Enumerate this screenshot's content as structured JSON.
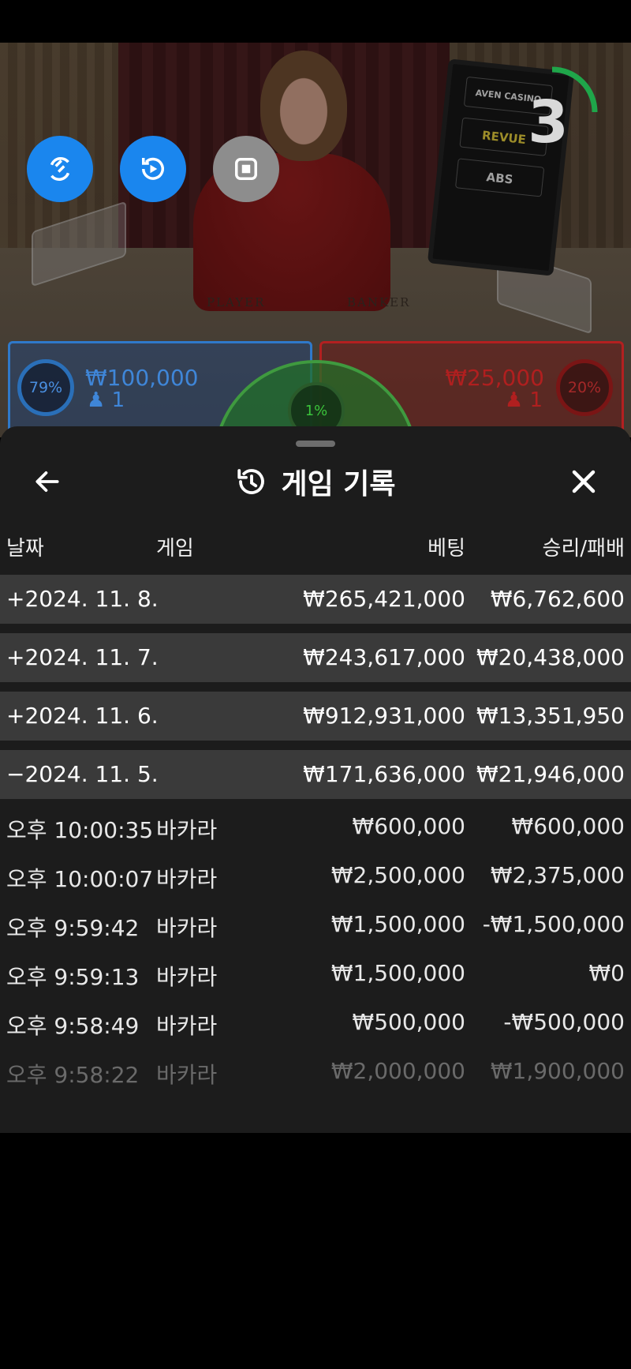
{
  "video": {
    "felt_player": "PLAYER",
    "felt_banker": "BANKER",
    "monitor_brands": [
      "AVEN CASINO",
      "REVUE",
      "ABS"
    ],
    "timer_seconds": "3"
  },
  "controls": {
    "buttons": [
      "switch-camera",
      "auto-play",
      "stop"
    ]
  },
  "betting": {
    "player": {
      "percent": "79%",
      "amount": "₩100,000",
      "players": "1"
    },
    "banker": {
      "percent": "20%",
      "amount": "₩25,000",
      "players": "1"
    },
    "tie": {
      "percent": "1%"
    }
  },
  "history": {
    "title": "게임 기록",
    "columns": {
      "date": "날짜",
      "game": "게임",
      "bet": "베팅",
      "win_loss": "승리/패배"
    },
    "days": [
      {
        "date": "+2024. 11. 8.",
        "bet": "₩265,421,000",
        "win": "₩6,762,600"
      },
      {
        "date": "+2024. 11. 7.",
        "bet": "₩243,617,000",
        "win": "₩20,438,000"
      },
      {
        "date": "+2024. 11. 6.",
        "bet": "₩912,931,000",
        "win": "₩13,351,950"
      },
      {
        "date": "−2024. 11. 5.",
        "bet": "₩171,636,000",
        "win": "₩21,946,000"
      }
    ],
    "entries": [
      {
        "time": "오후 10:00:35",
        "game": "바카라",
        "bet": "₩600,000",
        "win": "₩600,000"
      },
      {
        "time": "오후 10:00:07",
        "game": "바카라",
        "bet": "₩2,500,000",
        "win": "₩2,375,000"
      },
      {
        "time": "오후 9:59:42",
        "game": "바카라",
        "bet": "₩1,500,000",
        "win": "-₩1,500,000"
      },
      {
        "time": "오후 9:59:13",
        "game": "바카라",
        "bet": "₩1,500,000",
        "win": "₩0"
      },
      {
        "time": "오후 9:58:49",
        "game": "바카라",
        "bet": "₩500,000",
        "win": "-₩500,000"
      },
      {
        "time": "오후 9:58:22",
        "game": "바카라",
        "bet": "₩2,000,000",
        "win": "₩1,900,000"
      }
    ]
  },
  "colors": {
    "accent_blue": "#1a86ee",
    "player_blue": "#3f86d8",
    "banker_red": "#b01f1f",
    "tie_green": "#3bc43b",
    "sheet_bg": "#1c1c1c",
    "day_row_bg": "#3a3a3a"
  }
}
